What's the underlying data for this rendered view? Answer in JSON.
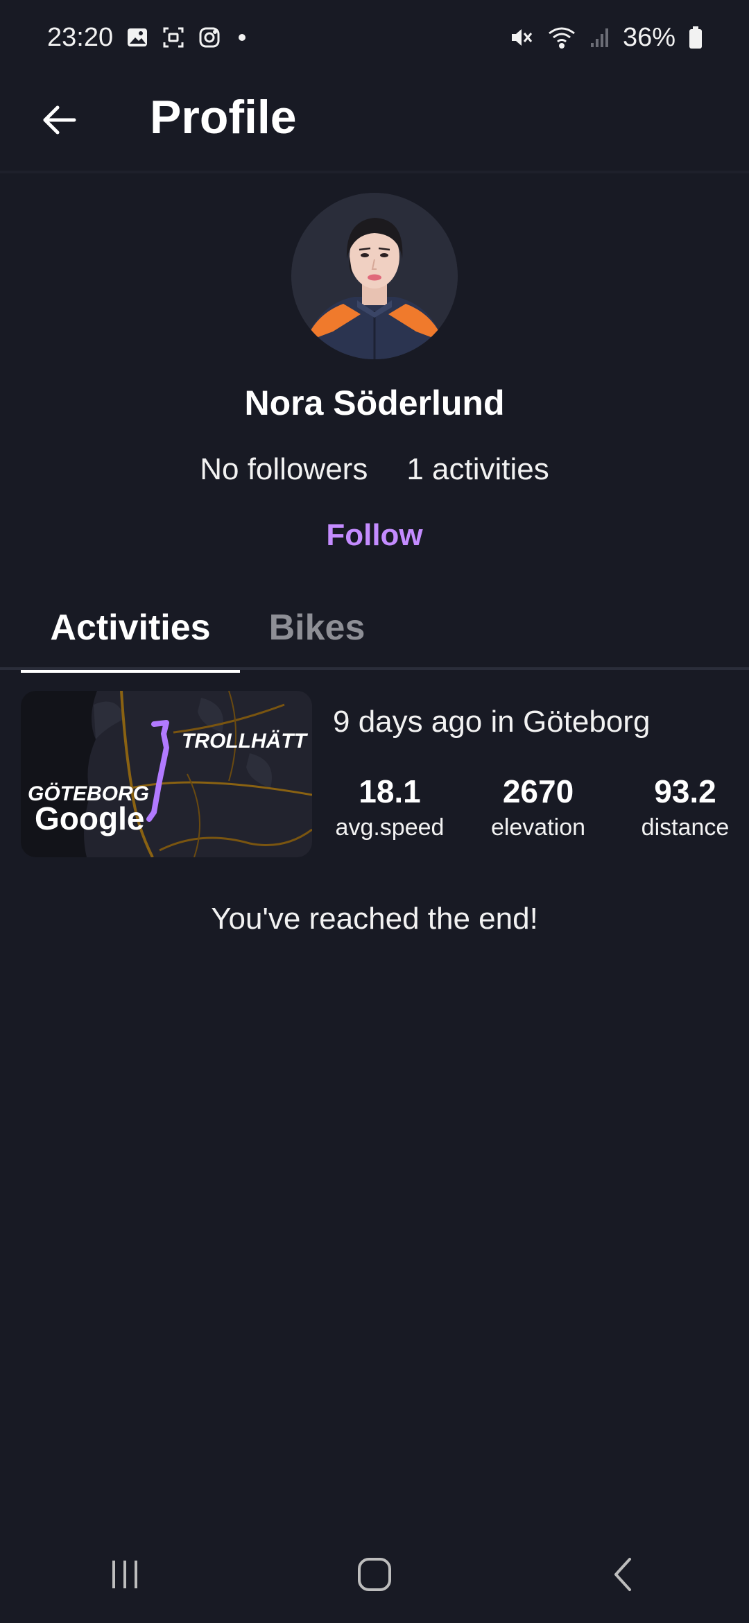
{
  "status_bar": {
    "time": "23:20",
    "battery": "36%",
    "icons_left": [
      "gallery-icon",
      "screenshot-icon",
      "instagram-icon",
      "dot-icon"
    ],
    "icons_right": [
      "mute-icon",
      "wifi-icon",
      "signal-icon",
      "battery-icon"
    ]
  },
  "app_bar": {
    "title": "Profile"
  },
  "profile": {
    "name": "Nora Söderlund",
    "followers": "No followers",
    "activities": "1 activities",
    "follow_label": "Follow"
  },
  "tabs": [
    {
      "label": "Activities",
      "active": true
    },
    {
      "label": "Bikes",
      "active": false
    }
  ],
  "activity": {
    "header": "9 days ago in Göteborg",
    "map": {
      "city_start": "GÖTEBORG",
      "city_end": "TROLLHÄTT",
      "watermark": "Google"
    },
    "metrics": [
      {
        "value": "18.1",
        "label": "avg.speed"
      },
      {
        "value": "2670",
        "label": "elevation"
      },
      {
        "value": "93.2",
        "label": "distance"
      }
    ]
  },
  "end_message": "You've reached the end!",
  "colors": {
    "background": "#181a24",
    "accent": "#c48cff",
    "tab_inactive": "#8e8f96"
  }
}
